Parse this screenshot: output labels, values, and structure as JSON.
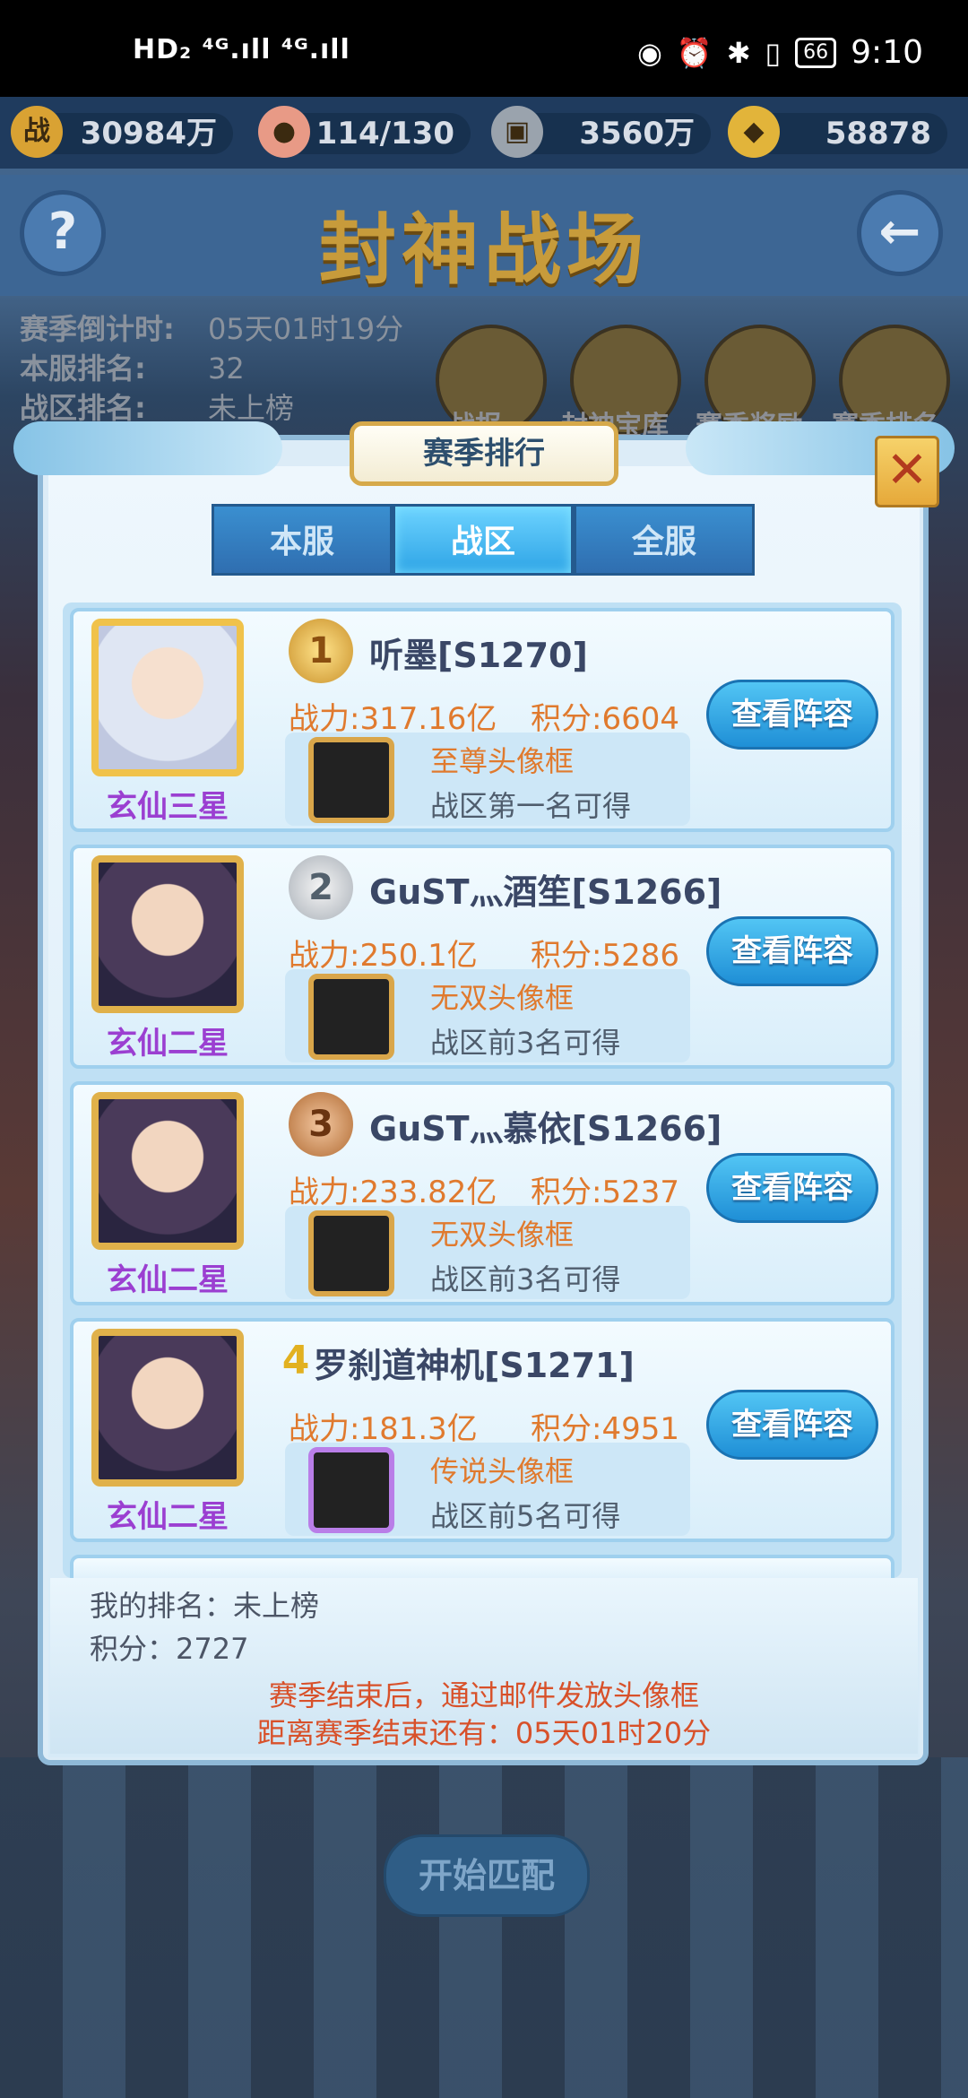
{
  "status_bar": {
    "left_text": "HD₂ ⁴ᴳ.ıll ⁴ᴳ.ıll ",
    "battery": "66",
    "time": "9:10"
  },
  "resources": [
    {
      "icon_name": "battle-power-icon",
      "icon_glyph": "战",
      "value": "30984万"
    },
    {
      "icon_name": "peach-stamina-icon",
      "icon_glyph": "●",
      "value": "114/130"
    },
    {
      "icon_name": "coin-icon",
      "icon_glyph": "▣",
      "value": "3560万"
    },
    {
      "icon_name": "gold-ingot-icon",
      "icon_glyph": "◆",
      "value": "58878"
    }
  ],
  "header": {
    "title": "封神战场",
    "help_glyph": "?",
    "back_glyph": "←"
  },
  "info": {
    "countdown_label": "赛季倒计时:",
    "countdown_value": "05天01时19分",
    "server_rank_label": "本服排名:",
    "server_rank_value": "32",
    "zone_rank_label": "战区排名:",
    "zone_rank_value": "未上榜"
  },
  "features": [
    "战报",
    "封神宝库",
    "赛季奖励",
    "赛季排名"
  ],
  "modal": {
    "title": "赛季排行",
    "close_glyph": "✕",
    "tabs": [
      {
        "label": "本服",
        "active": false
      },
      {
        "label": "战区",
        "active": true
      },
      {
        "label": "全服",
        "active": false
      }
    ],
    "entries": [
      {
        "rank": "1",
        "player": "听墨[S1270]",
        "title_label": "玄仙三星",
        "power": "战力:317.16亿",
        "score": "积分:6604",
        "frame_name": "至尊头像框",
        "frame_condition": "战区第一名可得",
        "button": "查看阵容"
      },
      {
        "rank": "2",
        "player": "GuST灬酒笙[S1266]",
        "title_label": "玄仙二星",
        "power": "战力:250.1亿",
        "score": "积分:5286",
        "frame_name": "无双头像框",
        "frame_condition": "战区前3名可得",
        "button": "查看阵容"
      },
      {
        "rank": "3",
        "player": "GuST灬慕依[S1266]",
        "title_label": "玄仙二星",
        "power": "战力:233.82亿",
        "score": "积分:5237",
        "frame_name": "无双头像框",
        "frame_condition": "战区前3名可得",
        "button": "查看阵容"
      },
      {
        "rank": "4",
        "player": "罗刹道神机[S1271]",
        "title_label": "玄仙二星",
        "power": "战力:181.3亿",
        "score": "积分:4951",
        "frame_name": "传说头像框",
        "frame_condition": "战区前5名可得",
        "button": "查看阵容"
      }
    ],
    "my_rank": "我的排名：未上榜",
    "my_score": "积分：2727",
    "notice_1": "赛季结束后，通过邮件发放头像框",
    "notice_2": "距离赛季结束还有：05天01时20分"
  },
  "match_button": "开始匹配"
}
